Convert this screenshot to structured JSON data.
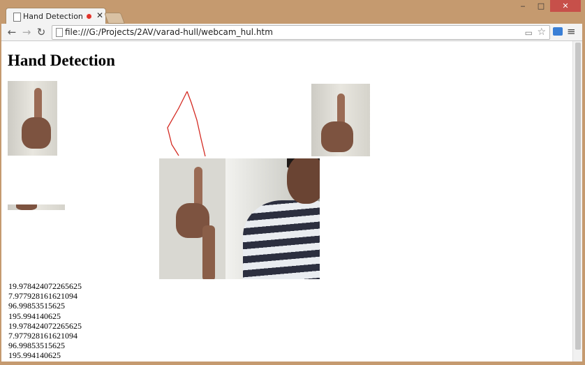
{
  "browser": {
    "tab_title": "Hand Detection",
    "url": "file:///G:/Projects/2AV/varad-hull/webcam_hul.htm"
  },
  "window_controls": {
    "minimize": "‒",
    "maximize": "□",
    "close": "✕"
  },
  "nav": {
    "back": "←",
    "forward": "→",
    "reload": "↻",
    "star": "☆",
    "menu": "≡"
  },
  "page": {
    "heading": "Hand Detection",
    "values": [
      "19.978424072265625",
      "7.977928161621094",
      "96.99853515625",
      "195.994140625",
      "19.978424072265625",
      "7.977928161621094",
      "96.99853515625",
      "195.994140625"
    ]
  },
  "icons": [
    "page-icon",
    "record-icon",
    "close-icon",
    "back-icon",
    "forward-icon",
    "reload-icon",
    "file-icon",
    "camera-icon",
    "star-icon",
    "extension-icon",
    "menu-icon"
  ]
}
